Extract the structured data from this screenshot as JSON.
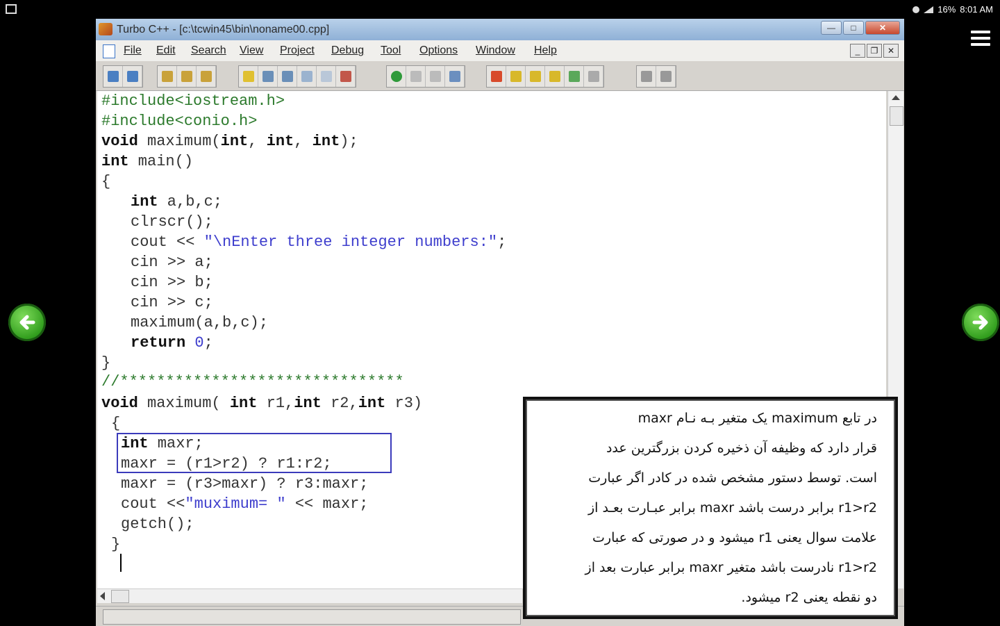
{
  "statusbar": {
    "time": "8:01 AM",
    "battery": "16%"
  },
  "window": {
    "title": "Turbo C++ - [c:\\tcwin45\\bin\\noname00.cpp]",
    "buttons": {
      "minimize": "—",
      "maximize": "□",
      "close": "✕"
    }
  },
  "menu": {
    "items": [
      "File",
      "Edit",
      "Search",
      "View",
      "Project",
      "Debug",
      "Tool",
      "Options",
      "Window",
      "Help"
    ],
    "mdi": {
      "minimize": "_",
      "restore": "❐",
      "close": "✕"
    }
  },
  "code": {
    "l1": "#include<iostream.h>",
    "l2": "#include<conio.h>",
    "l3a": "void",
    "l3b": " maximum(",
    "l3c": "int",
    "l3d": ", ",
    "l3e": "int",
    "l3f": ", ",
    "l3g": "int",
    "l3h": ");",
    "l4a": "int",
    "l4b": " main()",
    "l5": "{",
    "l6a": "int",
    "l6b": " a,b,c;",
    "l7": "clrscr();",
    "l8a": "cout << ",
    "l8b": "\"\\nEnter three integer numbers:\"",
    "l8c": ";",
    "l9": "cin >> a;",
    "l10": "cin >> b;",
    "l11": "cin >> c;",
    "l12": "maximum(a,b,c);",
    "l13a": "return",
    "l13b": " ",
    "l13c": "0",
    "l13d": ";",
    "l14": "}",
    "l15": "//*******************************",
    "l16a": "void",
    "l16b": " maximum( ",
    "l16c": "int",
    "l16d": " r1,",
    "l16e": "int",
    "l16f": " r2,",
    "l16g": "int",
    "l16h": " r3)",
    "l17": "{",
    "l18a": "int",
    "l18b": " maxr;",
    "l19": "maxr = (r1>r2) ? r1:r2;",
    "l20": "maxr = (r3>maxr) ? r3:maxr;",
    "l21a": "cout <<",
    "l21b": "\"muximum= \"",
    "l21c": " << maxr;",
    "l22": "getch();",
    "l23": "}"
  },
  "explanation": {
    "lines": [
      "در تابع maximum یک متغیر بـه نـام maxr",
      "قرار دارد که وظیفه آن ذخیره کردن بزرگترین عدد",
      "است. توسط دستور مشخص شده در کادر اگر عبارت",
      "r1>r2 برابر درست باشد maxr برابر عبـارت بعـد از",
      "علامت سوال یعنی r1 میشود و در صورتی که عبارت",
      "r1>r2 نادرست باشد متغیر maxr برابر عبارت بعد از",
      "دو نقطه یعنی r2 میشود."
    ]
  },
  "colors": {
    "preprocessor": "#2c7a2c",
    "string": "#3e3ecd",
    "highlight_box": "#3b3bbb",
    "nav_arrow": "#2d9a1a"
  }
}
